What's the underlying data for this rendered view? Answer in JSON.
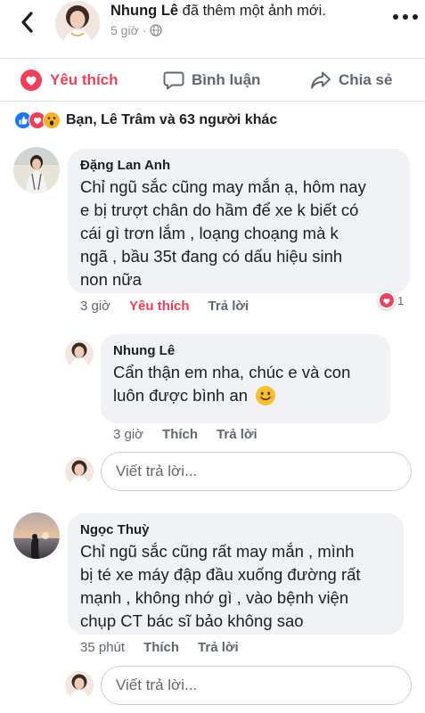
{
  "post": {
    "author": "Nhung Lê",
    "action_text": "đã thêm một ảnh mới.",
    "time": "5 giờ",
    "privacy_icon": "globe-icon"
  },
  "actions": {
    "like_label": "Yêu thích",
    "comment_label": "Bình luận",
    "share_label": "Chia sẻ",
    "like_color": "#f33e58"
  },
  "reactions": {
    "icons": [
      "like-reaction-icon",
      "love-reaction-icon",
      "wow-reaction-icon"
    ],
    "summary": "Bạn, Lê Trâm và 63 người khác"
  },
  "comments": [
    {
      "author": "Đặng Lan Anh",
      "lines": [
        "Chỉ ngũ sắc cũng may mắn ạ, hôm nay",
        "e bị trượt chân do hầm để xe k biết có",
        "cái gì trơn lắm , loạng choạng mà k",
        "ngã , bầu 35t đang có dấu hiệu sinh",
        "non nữa"
      ],
      "time": "3 giờ",
      "like_label": "Yêu thích",
      "reply_label": "Trả lời",
      "reaction_count": "1",
      "reply": {
        "author": "Nhung Lê",
        "lines": [
          "Cẩn thận em nha, chúc e và con",
          "luôn được bình an"
        ],
        "time": "3 giờ",
        "like_label": "Thích",
        "reply_label": "Trả lời"
      },
      "reply_placeholder": "Viết trả lời..."
    },
    {
      "author": "Ngọc Thuỳ",
      "lines": [
        "Chỉ ngũ sắc cũng rất may mắn , mình",
        "bị té xe máy đập đầu xuống đường rất",
        "mạnh , không nhớ gì , vào bệnh viện",
        "chụp CT bác sĩ bảo không sao"
      ],
      "time": "35 phút",
      "like_label": "Thích",
      "reply_label": "Trả lời",
      "reply_placeholder": "Viết trả lời..."
    }
  ]
}
